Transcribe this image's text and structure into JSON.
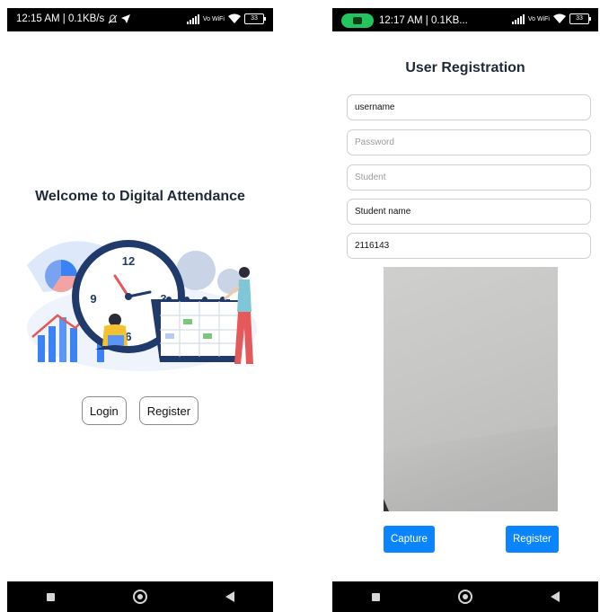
{
  "left_screen": {
    "status": {
      "time": "12:15 AM | 0.1KB/s",
      "volte": "Vo WiFi",
      "battery": "33"
    },
    "title": "Welcome to Digital Attendance",
    "clock_numbers": [
      "12",
      "9",
      "3",
      "6"
    ],
    "buttons": {
      "login": "Login",
      "register": "Register"
    }
  },
  "right_screen": {
    "status": {
      "time": "12:17 AM | 0.1KB...",
      "volte": "Vo WiFi",
      "battery": "33"
    },
    "title": "User Registration",
    "fields": [
      {
        "value": "username",
        "placeholder": ""
      },
      {
        "value": "",
        "placeholder": "Password"
      },
      {
        "value": "",
        "placeholder": "Student"
      },
      {
        "value": "Student name",
        "placeholder": ""
      },
      {
        "value": "2116143",
        "placeholder": ""
      }
    ],
    "buttons": {
      "capture": "Capture",
      "register": "Register"
    }
  },
  "colors": {
    "accent": "#0b84ff",
    "clock_navy": "#1f3a6b",
    "illustration_blue": "#3b82f6",
    "status_green": "#22c55e"
  }
}
